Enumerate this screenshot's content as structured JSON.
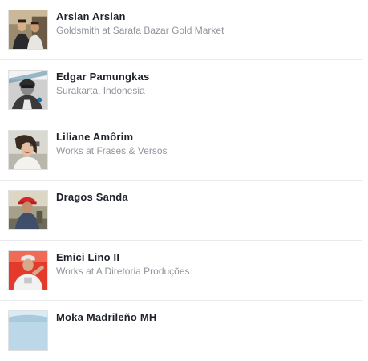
{
  "people": [
    {
      "name": "Arslan Arslan",
      "subtitle": "Goldsmith at Sarafa Bazar Gold Market",
      "avatar_icon": "profile-photo-two-men"
    },
    {
      "name": "Edgar Pamungkas",
      "subtitle": "Surakarta, Indonesia",
      "avatar_icon": "profile-photo-selfie-black-white"
    },
    {
      "name": "Liliane Amôrim",
      "subtitle": "Works at Frases & Versos",
      "avatar_icon": "profile-photo-woman"
    },
    {
      "name": "Dragos Sanda",
      "subtitle": "",
      "avatar_icon": "profile-photo-man-red-cap"
    },
    {
      "name": "Emici Lino II",
      "subtitle": "Works at A Diretoria Produções",
      "avatar_icon": "profile-photo-man-red-background"
    },
    {
      "name": "Moka Madrileño MH",
      "subtitle": "",
      "avatar_icon": "profile-photo-sky"
    }
  ]
}
